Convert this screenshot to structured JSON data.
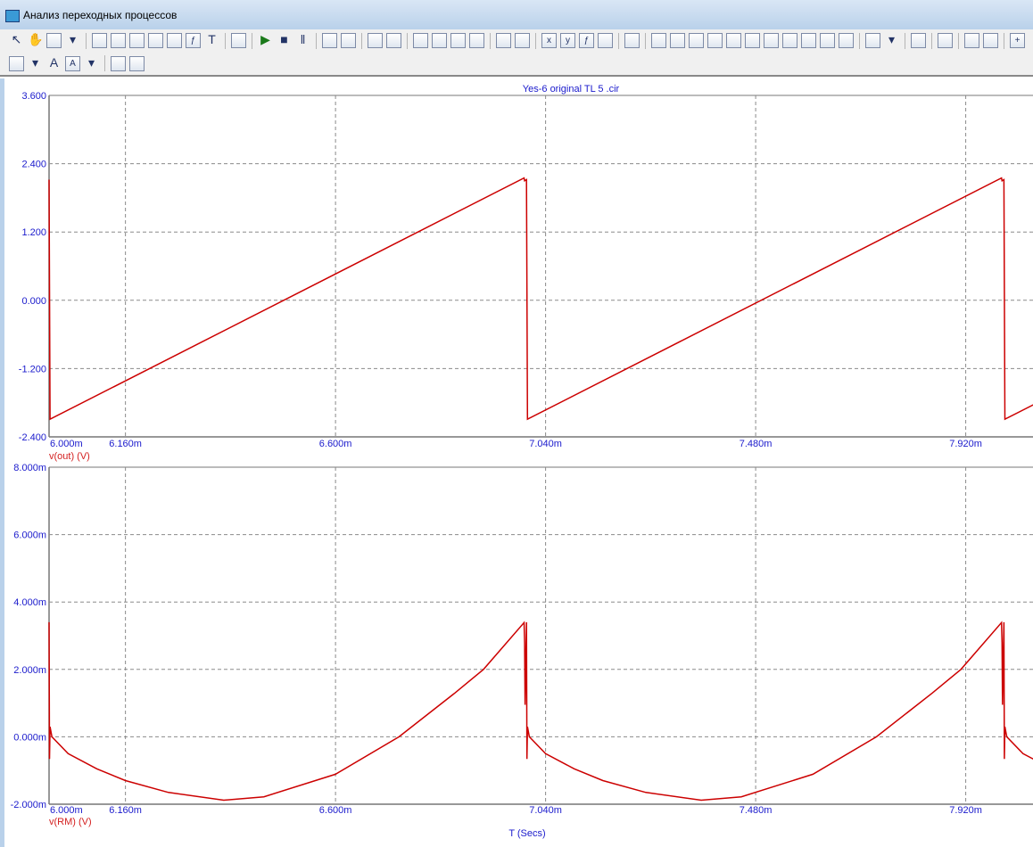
{
  "window": {
    "title": "Анализ переходных процессов"
  },
  "toolbar": {
    "row1": [
      "select-arrow-icon",
      "pan-hand-icon",
      "copy-icon",
      "dropdown-arrow-icon",
      "sep",
      "scale-icon",
      "data-points-icon",
      "cursor-mode-icon",
      "vertical-scale-icon",
      "tracking-icon",
      "formula-icon",
      "text-icon",
      "sep",
      "properties-icon",
      "sep",
      "run-icon",
      "stop-icon",
      "pause-icon",
      "sep",
      "go-left-icon",
      "go-right-icon",
      "sep",
      "frame-icon",
      "grid-icon",
      "sep",
      "vertical-lines-icon",
      "horizontal-lines-icon",
      "double-lines-icon",
      "single-line-icon",
      "sep",
      "horizontal-axis-icon",
      "crosshair-icon",
      "sep",
      "x-axis-icon",
      "y-axis-icon",
      "fx-icon",
      "equal-icon",
      "sep",
      "table-icon",
      "sep",
      "next-point-icon",
      "prev-point-icon",
      "peak-icon",
      "valley-icon",
      "high-icon",
      "low-icon",
      "inflection-icon",
      "global-high-icon",
      "global-low-icon",
      "top-icon",
      "bottom-icon",
      "sep",
      "clipboard-icon",
      "dropdown-arrow-icon",
      "sep",
      "list-icon",
      "sep",
      "numeric-icon",
      "sep",
      "fit-horizontal-icon",
      "fit-vertical-icon",
      "sep",
      "zoom-in-icon"
    ],
    "row2": [
      "layout-grid-icon",
      "dropdown-arrow-icon",
      "font-icon",
      "font-color-icon",
      "dropdown-arrow-icon",
      "sep",
      "bring-front-icon",
      "send-back-icon"
    ]
  },
  "plot": {
    "title": "Yes-6 original TL 5 .cir",
    "xlabel": "T (Secs)",
    "trace_color": "#cc0000",
    "label_color": "#1a1acc"
  },
  "chart_data": [
    {
      "type": "line",
      "name": "v(out) (V)",
      "ylabel": "v(out) (V)",
      "xlim_ms": [
        6.0,
        8.062
      ],
      "ylim": [
        -2.4,
        3.6
      ],
      "yticks": [
        "3.600",
        "2.400",
        "1.200",
        "0.000",
        "-1.200",
        "-2.400"
      ],
      "ytick_values": [
        3.6,
        2.4,
        1.2,
        0,
        -1.2,
        -2.4
      ],
      "xticks": [
        "6.000m",
        "6.160m",
        "6.600m",
        "7.040m",
        "7.480m",
        "7.920m"
      ],
      "xtick_values_ms": [
        6.0,
        6.16,
        6.6,
        7.04,
        7.48,
        7.92
      ],
      "grid": true,
      "period_ms": 1.0,
      "cycle_points_ms_v": [
        [
          0,
          2.12
        ],
        [
          0.002,
          -2.09
        ],
        [
          0.995,
          2.15
        ],
        [
          0.996,
          2.1
        ]
      ]
    },
    {
      "type": "line",
      "name": "v(RM) (V)",
      "ylabel": "v(RM) (V)",
      "xlim_ms": [
        6.0,
        8.062
      ],
      "ylim": [
        -2.0,
        8.0
      ],
      "yticks": [
        "8.000m",
        "6.000m",
        "4.000m",
        "2.000m",
        "0.000m",
        "-2.000m"
      ],
      "ytick_values": [
        8,
        6,
        4,
        2,
        0,
        -2
      ],
      "yunit": "mV",
      "xticks": [
        "6.000m",
        "6.160m",
        "6.600m",
        "7.040m",
        "7.480m",
        "7.920m"
      ],
      "xtick_values_ms": [
        6.0,
        6.16,
        6.6,
        7.04,
        7.48,
        7.92
      ],
      "grid": true,
      "period_ms": 1.0,
      "cycle_points_ms_v": [
        [
          0,
          3.4
        ],
        [
          0.001,
          -0.66
        ],
        [
          0.002,
          0.3
        ],
        [
          0.006,
          0.0
        ],
        [
          0.04,
          -0.5
        ],
        [
          0.1,
          -0.95
        ],
        [
          0.16,
          -1.3
        ],
        [
          0.25,
          -1.65
        ],
        [
          0.366,
          -1.88
        ],
        [
          0.45,
          -1.78
        ],
        [
          0.6,
          -1.11
        ],
        [
          0.733,
          0.0
        ],
        [
          0.85,
          1.3
        ],
        [
          0.91,
          2.0
        ],
        [
          0.995,
          3.39
        ],
        [
          0.996,
          2.8
        ],
        [
          0.997,
          0.95
        ]
      ]
    }
  ]
}
